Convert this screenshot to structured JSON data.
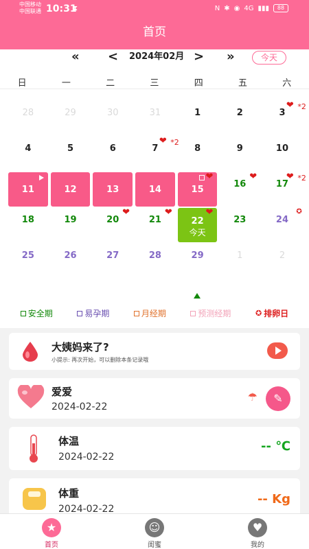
{
  "status": {
    "carrier1": "中国移动",
    "carrier2": "中国联通",
    "time": "10:31",
    "network": "4G",
    "battery": "88"
  },
  "header": {
    "title": "首页"
  },
  "calendar": {
    "prev_year": "«",
    "prev_month": "<",
    "month": "2024年02月",
    "next_month": ">",
    "next_year": "»",
    "today_button": "今天",
    "weekdays": [
      "日",
      "一",
      "二",
      "三",
      "四",
      "五",
      "六"
    ],
    "days": [
      {
        "n": "28",
        "t": "faded"
      },
      {
        "n": "29",
        "t": "faded"
      },
      {
        "n": "30",
        "t": "faded"
      },
      {
        "n": "31",
        "t": "faded"
      },
      {
        "n": "1",
        "t": "normal"
      },
      {
        "n": "2",
        "t": "normal"
      },
      {
        "n": "3",
        "t": "normal",
        "heart": "*2"
      },
      {
        "n": "4",
        "t": "normal"
      },
      {
        "n": "5",
        "t": "normal"
      },
      {
        "n": "6",
        "t": "normal"
      },
      {
        "n": "7",
        "t": "normal",
        "heart": "*2"
      },
      {
        "n": "8",
        "t": "normal"
      },
      {
        "n": "9",
        "t": "normal"
      },
      {
        "n": "10",
        "t": "normal"
      },
      {
        "n": "11",
        "t": "period",
        "flag": true
      },
      {
        "n": "12",
        "t": "period"
      },
      {
        "n": "13",
        "t": "period"
      },
      {
        "n": "14",
        "t": "period"
      },
      {
        "n": "15",
        "t": "period",
        "heart": "",
        "square": true
      },
      {
        "n": "16",
        "t": "safe",
        "heart": ""
      },
      {
        "n": "17",
        "t": "safe",
        "heart": "*2"
      },
      {
        "n": "18",
        "t": "safe"
      },
      {
        "n": "19",
        "t": "safe"
      },
      {
        "n": "20",
        "t": "safe",
        "heart": ""
      },
      {
        "n": "21",
        "t": "safe",
        "heart": ""
      },
      {
        "n": "22",
        "t": "today",
        "heart": "",
        "sub": "今天"
      },
      {
        "n": "23",
        "t": "safe"
      },
      {
        "n": "24",
        "t": "fertile",
        "ovul": true
      },
      {
        "n": "25",
        "t": "fertile"
      },
      {
        "n": "26",
        "t": "fertile"
      },
      {
        "n": "27",
        "t": "fertile"
      },
      {
        "n": "28",
        "t": "fertile"
      },
      {
        "n": "29",
        "t": "fertile"
      },
      {
        "n": "1",
        "t": "faded"
      },
      {
        "n": "2",
        "t": "faded"
      }
    ]
  },
  "legend": [
    {
      "label": "安全期",
      "color": "#12880a",
      "kind": "box"
    },
    {
      "label": "易孕期",
      "color": "#6a4fb0",
      "kind": "box"
    },
    {
      "label": "月经期",
      "color": "#e0712b",
      "kind": "box"
    },
    {
      "label": "预测经期",
      "color": "#f2a3b8",
      "kind": "box"
    },
    {
      "label": "排卵日",
      "color": "#dd1c1c",
      "kind": "star"
    }
  ],
  "cards": {
    "period": {
      "title": "大姨妈来了?",
      "hint": "小提示: 再次开始，可以删除本条记录哦"
    },
    "love": {
      "title": "爱爱",
      "date": "2024-02-22"
    },
    "temperature": {
      "title": "体温",
      "date": "2024-02-22",
      "value": "-- ℃"
    },
    "weight": {
      "title": "体重",
      "date": "2024-02-22",
      "value": "-- Kg"
    }
  },
  "nav": [
    {
      "label": "首页",
      "icon": "star-icon",
      "active": true
    },
    {
      "label": "闺蜜",
      "icon": "friends-icon",
      "active": false
    },
    {
      "label": "我的",
      "icon": "heart-profile-icon",
      "active": false
    }
  ],
  "colors": {
    "brand": "#fd6a96",
    "safe": "#12880a",
    "fertile": "#8469c6",
    "today": "#7cc414",
    "period": "#f85a88"
  }
}
